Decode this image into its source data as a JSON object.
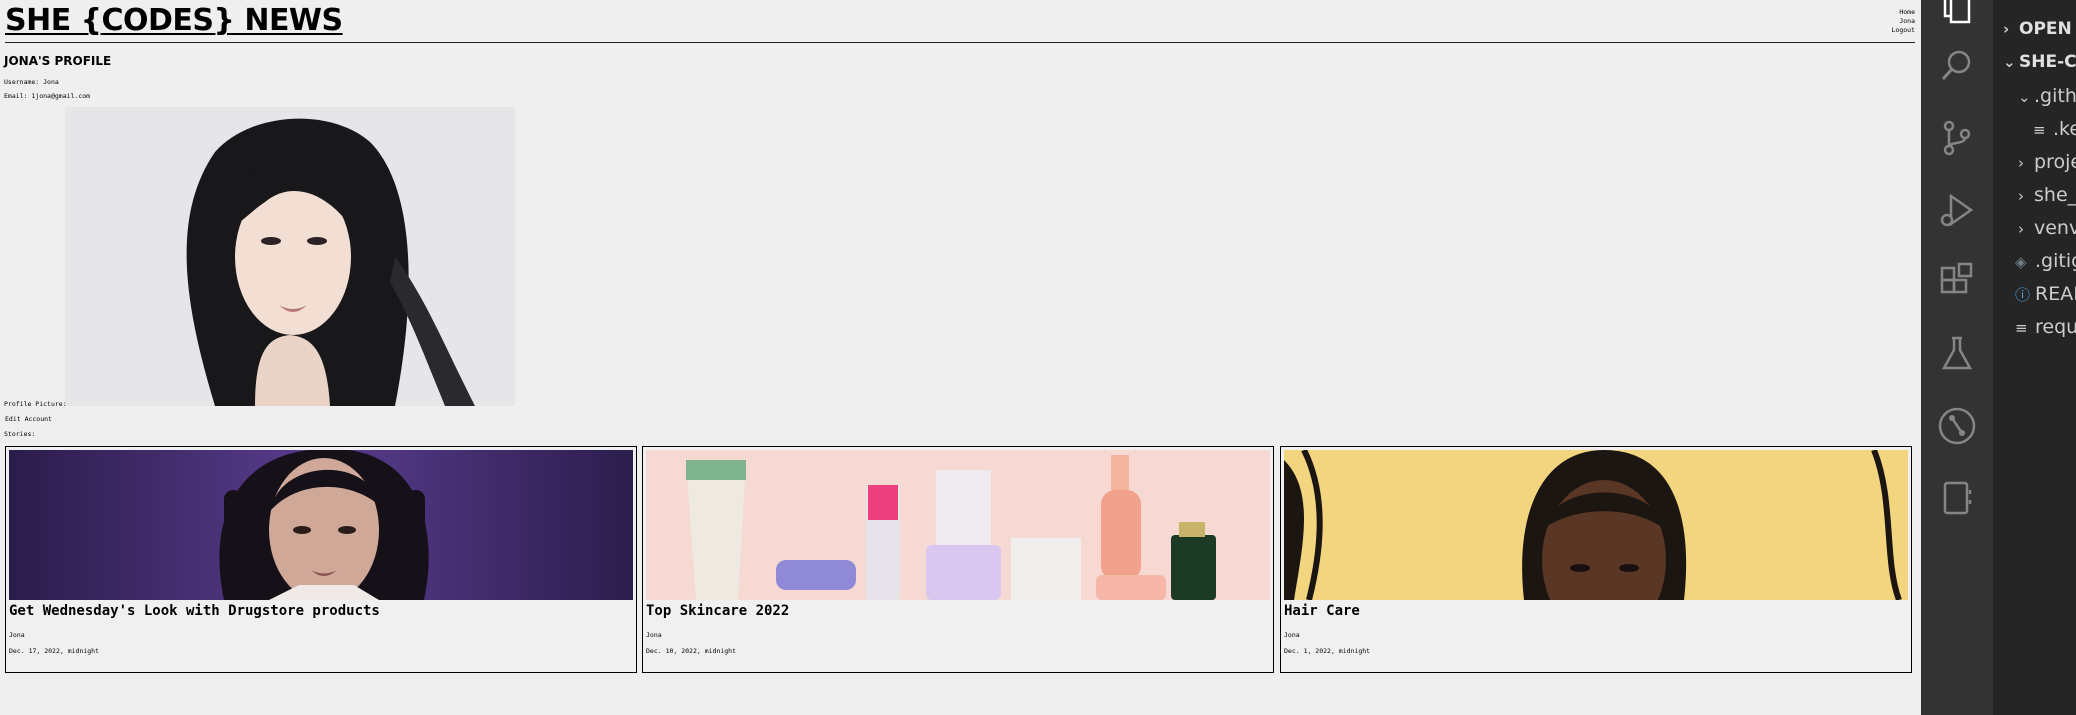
{
  "site": {
    "brand": "SHE {CODES} NEWS",
    "nav": [
      "Home",
      "Jona",
      "Logout"
    ],
    "profile_heading": "JONA'S PROFILE",
    "username_line": "Username: Jona",
    "email_line": "Email: 1jona@gmail.com",
    "profile_picture_label": "Profile Picture:",
    "edit_account_label": "Edit Account",
    "stories_label": "Stories:",
    "stories": [
      {
        "title": "Get Wednesday's Look with Drugstore products",
        "author": "Jona",
        "date": "Dec. 17, 2022, midnight"
      },
      {
        "title": "Top Skincare 2022",
        "author": "Jona",
        "date": "Dec. 10, 2022, midnight"
      },
      {
        "title": "Hair Care",
        "author": "Jona",
        "date": "Dec. 1, 2022, midnight"
      }
    ]
  },
  "vscode": {
    "activity_icons": [
      "explorer-icon",
      "search-icon",
      "source-control-icon",
      "run-debug-icon",
      "extensions-icon",
      "testing-icon",
      "git-graph-icon",
      "notebook-icon"
    ],
    "explorer": {
      "open_editors": "OPEN EDITORS",
      "project": "SHE-CODES",
      "items": [
        {
          "label": ".github",
          "kind": "folder-open"
        },
        {
          "label": ".keep",
          "kind": "file"
        },
        {
          "label": "projects",
          "kind": "folder"
        },
        {
          "label": "she_codes",
          "kind": "folder"
        },
        {
          "label": "venv",
          "kind": "folder"
        },
        {
          "label": ".gitignore",
          "kind": "file"
        },
        {
          "label": "README.md",
          "kind": "info-file"
        },
        {
          "label": "requirements.txt",
          "kind": "file"
        }
      ]
    },
    "colors": {
      "activity_bar": "#333333",
      "sidebar": "#252526",
      "text": "#cccccc"
    }
  }
}
